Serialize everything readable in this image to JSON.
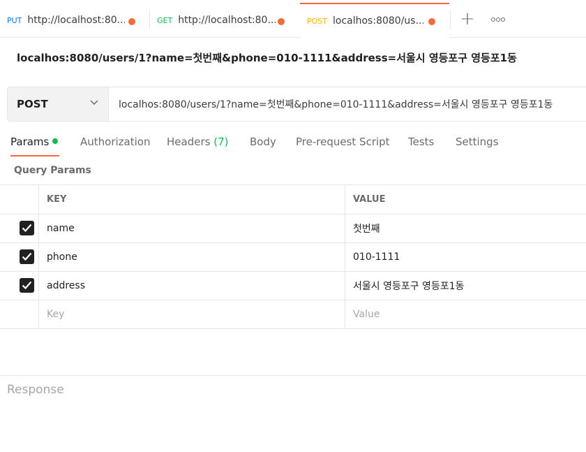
{
  "tabs": [
    {
      "method": "PUT",
      "title": "http://localhost:80...",
      "method_color": "#097bed",
      "dot_color": "#f26b3a"
    },
    {
      "method": "GET",
      "title": "http://localhost:80...",
      "method_color": "#0cbb52",
      "dot_color": "#f26b3a"
    },
    {
      "method": "POST",
      "title": "localhos:8080/us...",
      "method_color": "#ffb400",
      "dot_color": "#f26b3a"
    }
  ],
  "request": {
    "name": "localhos:8080/users/1?name=첫번째&phone=010-1111&address=서울시 영등포구 영등포1동",
    "method": "POST",
    "url": "localhos:8080/users/1?name=첫번째&phone=010-1111&address=서울시 영등포구 영등포1동"
  },
  "subtabs": {
    "params": "Params",
    "authorization": "Authorization",
    "headers": "Headers",
    "headers_count": "(7)",
    "body": "Body",
    "prerequest": "Pre-request Script",
    "tests": "Tests",
    "settings": "Settings"
  },
  "query_params": {
    "label": "Query Params",
    "columns": {
      "key": "KEY",
      "value": "VALUE"
    },
    "rows": [
      {
        "key": "name",
        "value": "첫번째",
        "checked": true
      },
      {
        "key": "phone",
        "value": "010-1111",
        "checked": true
      },
      {
        "key": "address",
        "value": "서울시 영등포구 영등포1동",
        "checked": true
      }
    ],
    "placeholder": {
      "key": "Key",
      "value": "Value"
    }
  },
  "response": {
    "label": "Response"
  },
  "colors": {
    "accent": "#f26b3a",
    "green": "#0cbb52"
  }
}
